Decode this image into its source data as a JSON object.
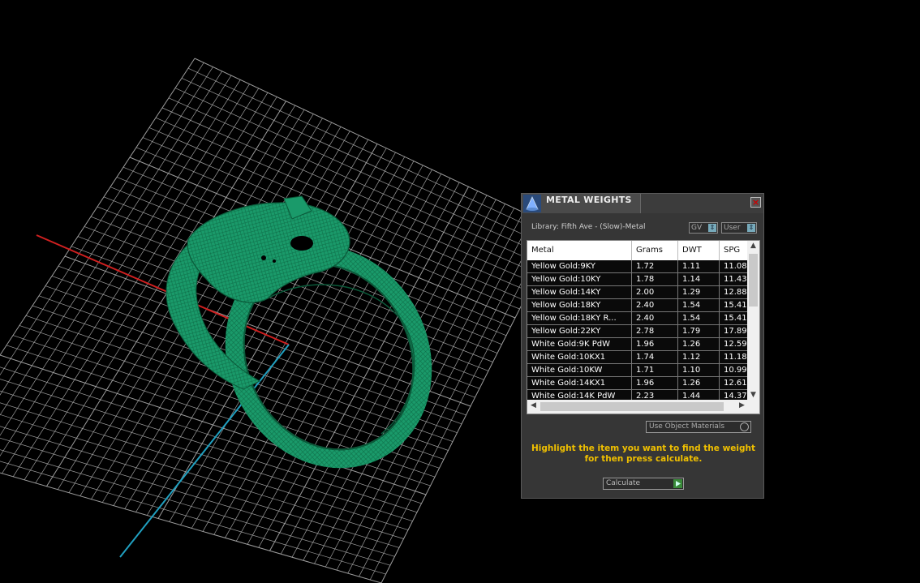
{
  "panel": {
    "title": "METAL WEIGHTS",
    "close_glyph": "×",
    "library_label": "Library: Fifth Ave - (Slow)-Metal",
    "gv_select": "GV",
    "user_select": "User",
    "use_object_materials": "Use Object Materials",
    "hint": "Highlight the item you want to find the weight for then press calculate.",
    "calculate": "Calculate"
  },
  "table": {
    "headers": [
      "Metal",
      "Grams",
      "DWT",
      "SPG"
    ],
    "rows": [
      [
        "Yellow Gold:9KY",
        "1.72",
        "1.11",
        "11.08"
      ],
      [
        "Yellow Gold:10KY",
        "1.78",
        "1.14",
        "11.43"
      ],
      [
        "Yellow Gold:14KY",
        "2.00",
        "1.29",
        "12.88"
      ],
      [
        "Yellow Gold:18KY",
        "2.40",
        "1.54",
        "15.41"
      ],
      [
        "Yellow Gold:18KY R...",
        "2.40",
        "1.54",
        "15.41"
      ],
      [
        "Yellow Gold:22KY",
        "2.78",
        "1.79",
        "17.89"
      ],
      [
        "White Gold:9K PdW",
        "1.96",
        "1.26",
        "12.59"
      ],
      [
        "White Gold:10KX1",
        "1.74",
        "1.12",
        "11.18"
      ],
      [
        "White Gold:10KW",
        "1.71",
        "1.10",
        "10.99"
      ],
      [
        "White Gold:14KX1",
        "1.96",
        "1.26",
        "12.61"
      ],
      [
        "White Gold:14K PdW",
        "2.23",
        "1.44",
        "14.37"
      ]
    ]
  },
  "colors": {
    "ring": "#1a9a6a",
    "axis_x": "#d02020",
    "axis_z": "#20a0c0",
    "grid": "#b8b8b8",
    "hint": "#f0c000"
  }
}
